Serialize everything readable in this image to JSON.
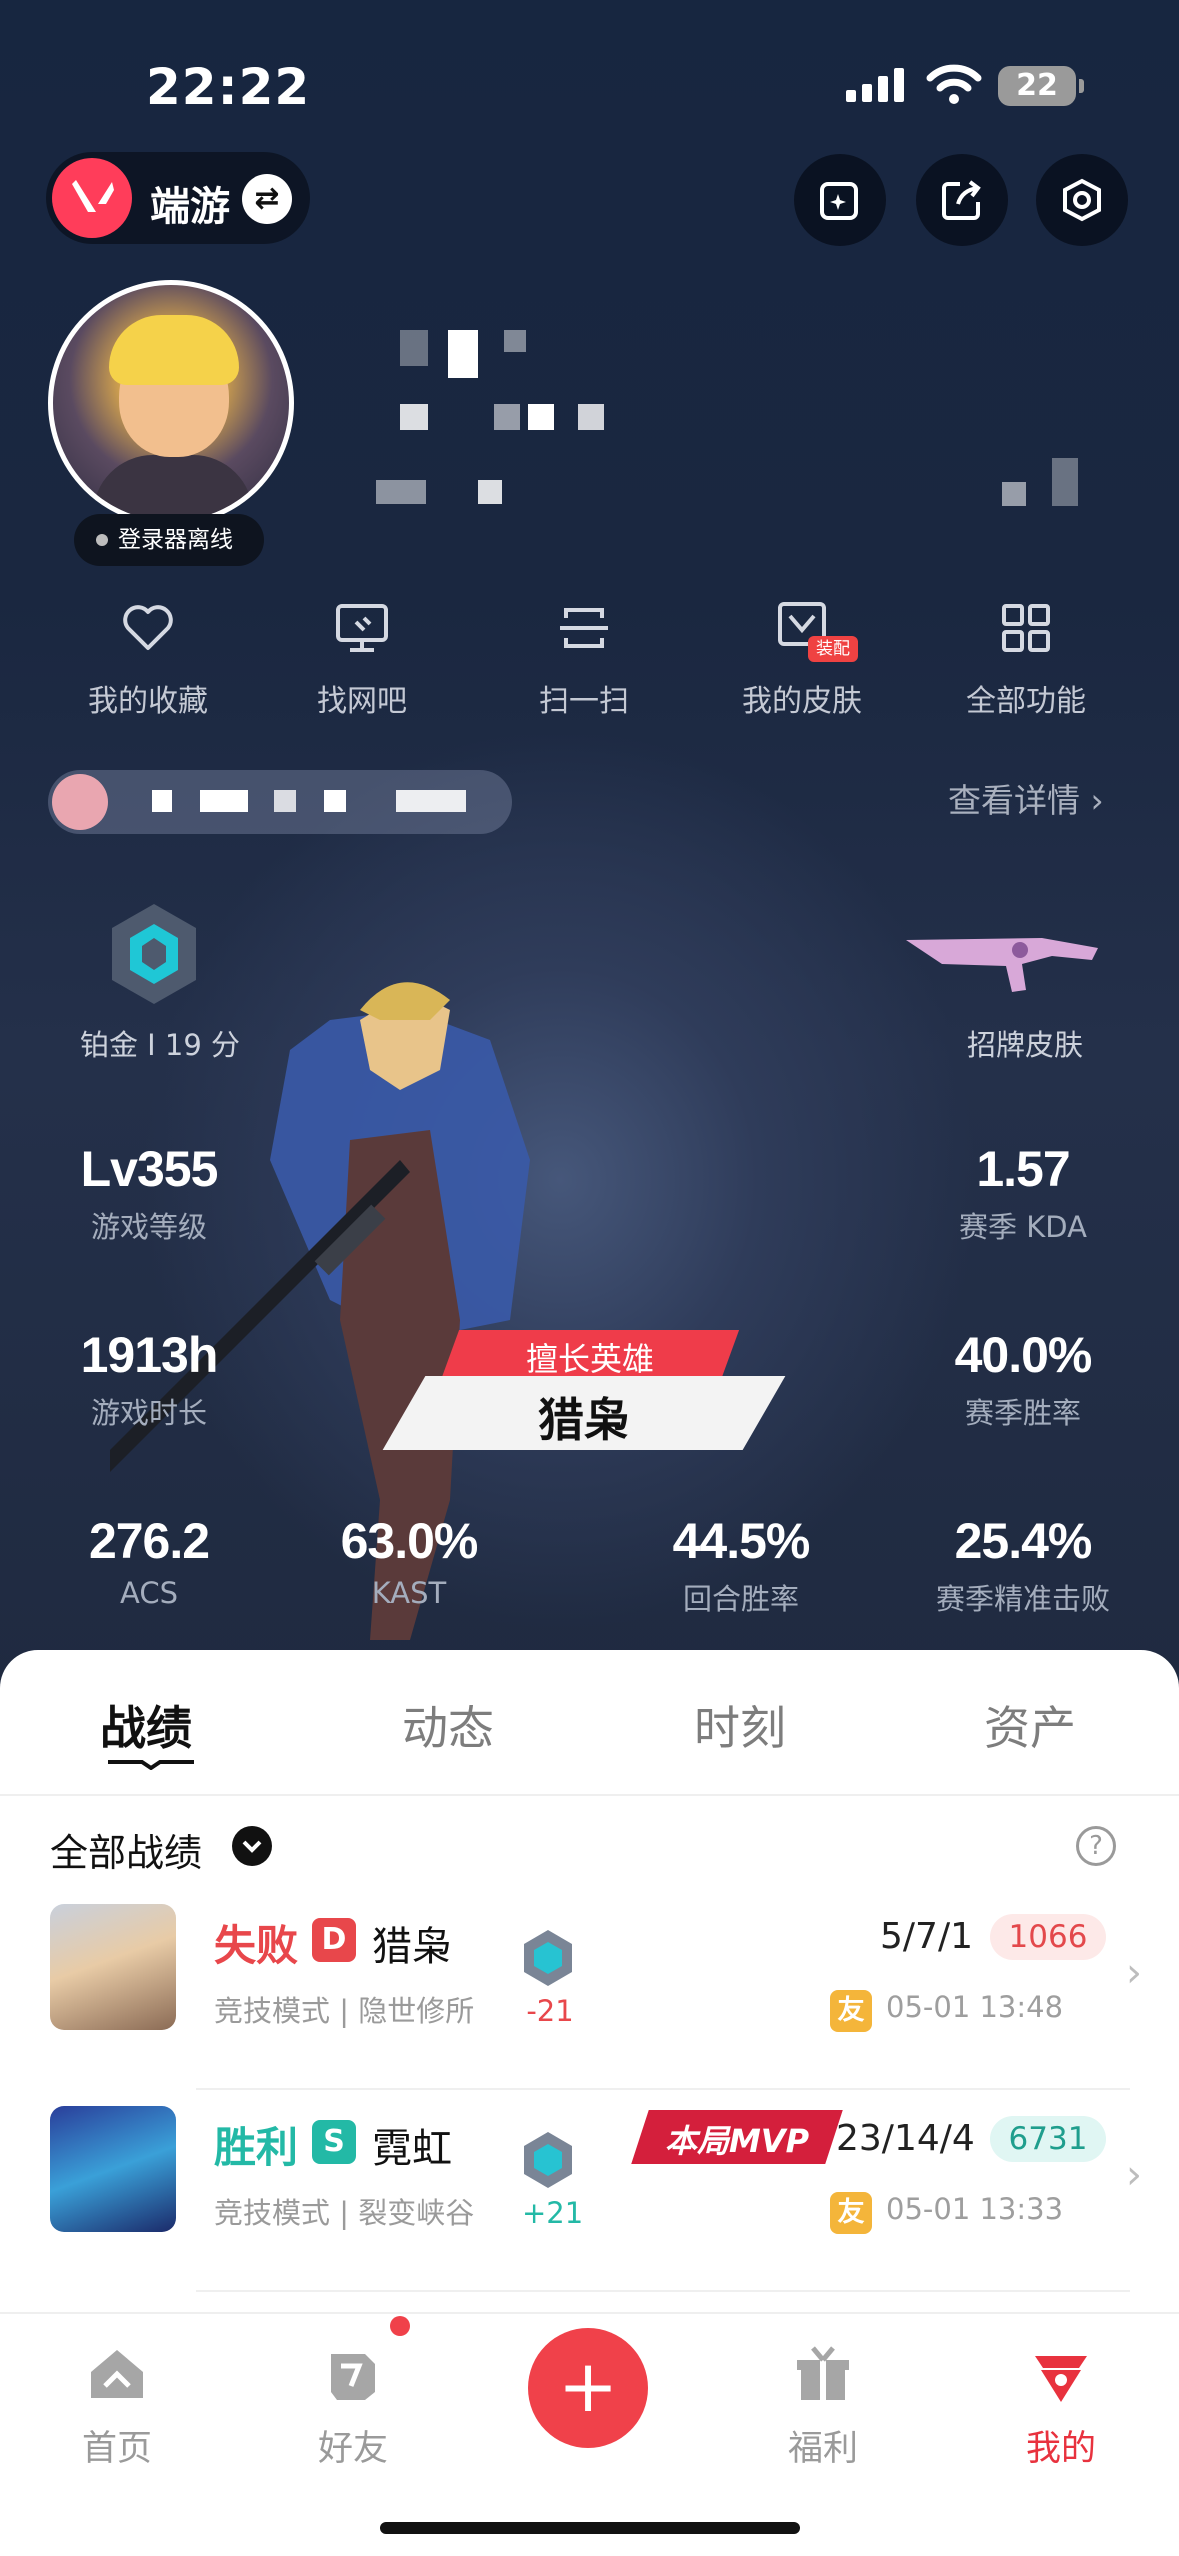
{
  "status": {
    "time": "22:22",
    "battery": "22"
  },
  "header": {
    "game": "端游",
    "swap_icon": "swap-icon",
    "icons": [
      "add-card-icon",
      "share-icon",
      "settings-icon"
    ]
  },
  "profile": {
    "login_status": "登录器离线"
  },
  "shortcuts": [
    {
      "label": "我的收藏",
      "icon": "heart-icon"
    },
    {
      "label": "找网吧",
      "icon": "monitor-icon"
    },
    {
      "label": "扫一扫",
      "icon": "scan-icon"
    },
    {
      "label": "我的皮肤",
      "icon": "skin-icon",
      "tag": "装配"
    },
    {
      "label": "全部功能",
      "icon": "grid-icon"
    }
  ],
  "friend_bar": {
    "details": "查看详情"
  },
  "rank": {
    "label": "铂金 I 19 分"
  },
  "skin": {
    "label": "招牌皮肤"
  },
  "stats": {
    "level": {
      "value": "Lv355",
      "label": "游戏等级"
    },
    "kda": {
      "value": "1.57",
      "label": "赛季 KDA"
    },
    "hours": {
      "value": "1913h",
      "label": "游戏时长"
    },
    "winrate": {
      "value": "40.0%",
      "label": "赛季胜率"
    },
    "acs": {
      "value": "276.2",
      "label": "ACS"
    },
    "kast": {
      "value": "63.0%",
      "label": "KAST"
    },
    "round": {
      "value": "44.5%",
      "label": "回合胜率"
    },
    "headshot": {
      "value": "25.4%",
      "label": "赛季精准击败"
    }
  },
  "hero": {
    "tag": "擅长英雄",
    "name": "猎枭"
  },
  "tabs": [
    "战绩",
    "动态",
    "时刻",
    "资产"
  ],
  "filter": {
    "label": "全部战绩",
    "help": "?"
  },
  "matches": [
    {
      "result": "失败",
      "badge": "D",
      "agent": "猎枭",
      "mode": "竞技模式 | 隐世修所",
      "delta": "-21",
      "kda": "5/7/1",
      "score": "1066",
      "friend": "友",
      "time": "05-01 13:48",
      "color": "#e8474b",
      "score_bg": "#fde9e8",
      "score_color": "#e3484b"
    },
    {
      "result": "胜利",
      "badge": "S",
      "agent": "霓虹",
      "mode": "竞技模式 | 裂变峡谷",
      "delta": "+21",
      "kda": "23/14/4",
      "score": "6731",
      "friend": "友",
      "time": "05-01 13:33",
      "color": "#23b9a6",
      "score_bg": "#e0f6f3",
      "score_color": "#1f9e8d",
      "mvp": "本局MVP"
    }
  ],
  "nav": [
    {
      "label": "首页",
      "icon": "home-icon"
    },
    {
      "label": "好友",
      "icon": "friends-icon"
    },
    {
      "label": "福利",
      "icon": "gift-icon"
    },
    {
      "label": "我的",
      "icon": "profile-icon"
    }
  ],
  "nav_plus": "+",
  "colors": {
    "accent": "#f0414a",
    "win": "#23b9a6",
    "loss": "#e8474b"
  }
}
